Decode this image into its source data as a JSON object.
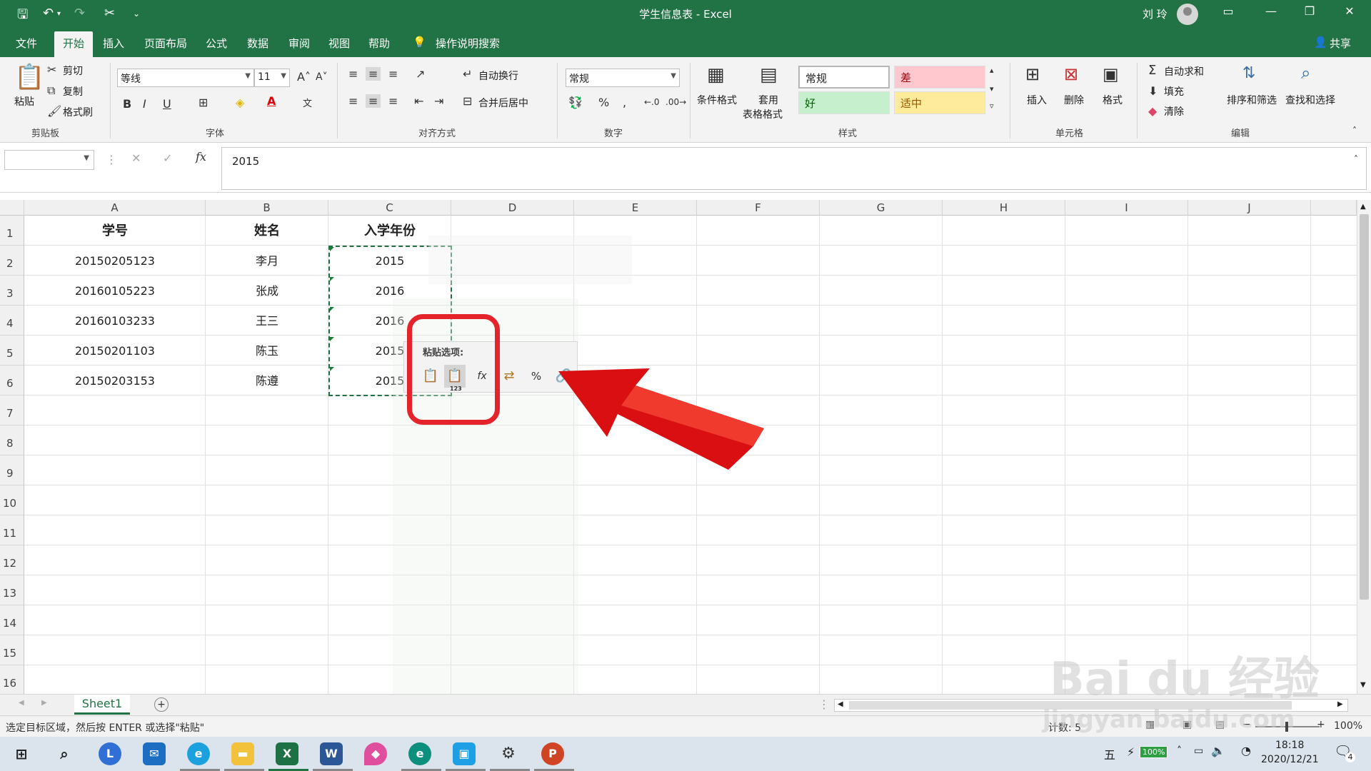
{
  "window": {
    "title": "学生信息表 - Excel",
    "user": "刘 玲"
  },
  "tabs": [
    "文件",
    "开始",
    "插入",
    "页面布局",
    "公式",
    "数据",
    "审阅",
    "视图",
    "帮助"
  ],
  "search_tab": "操作说明搜索",
  "share": "共享",
  "ribbon": {
    "clipboard": {
      "paste": "粘贴",
      "cut": "剪切",
      "copy": "复制",
      "painter": "格式刷",
      "label": "剪贴板"
    },
    "font": {
      "name": "等线",
      "size": "11",
      "label": "字体"
    },
    "align": {
      "wrap": "自动换行",
      "merge": "合并后居中",
      "label": "对齐方式"
    },
    "number": {
      "format": "常规",
      "label": "数字"
    },
    "styles": {
      "cond": "条件格式",
      "table1": "套用",
      "table2": "表格格式",
      "normal": "常规",
      "bad": "差",
      "good": "好",
      "neutral": "适中",
      "label": "样式"
    },
    "cells": {
      "insert": "插入",
      "delete": "删除",
      "format": "格式",
      "label": "单元格"
    },
    "edit": {
      "autosum": "自动求和",
      "fill": "填充",
      "clear": "清除",
      "sort": "排序和筛选",
      "find": "查找和选择",
      "label": "编辑"
    }
  },
  "formula": {
    "value": "2015"
  },
  "columns": [
    "A",
    "B",
    "C",
    "D",
    "E",
    "F",
    "G",
    "H",
    "I",
    "J"
  ],
  "rows": [
    "1",
    "2",
    "3",
    "4",
    "5",
    "6",
    "7",
    "8",
    "9",
    "10",
    "11",
    "12",
    "13",
    "14",
    "15",
    "16"
  ],
  "table": {
    "headers": [
      "学号",
      "姓名",
      "入学年份"
    ],
    "data": [
      [
        "20150205123",
        "李月",
        "2015"
      ],
      [
        "20160105223",
        "张成",
        "2016"
      ],
      [
        "20160103233",
        "王三",
        "2016"
      ],
      [
        "20150201103",
        "陈玉",
        "2015"
      ],
      [
        "20150203153",
        "陈遵",
        "2015"
      ]
    ]
  },
  "paste_menu": {
    "title": "粘贴选项:",
    "values_badge": "123"
  },
  "sheet": {
    "name": "Sheet1"
  },
  "status": {
    "text": "选定目标区域，然后按 ENTER 或选择\"粘贴\"",
    "count": "计数: 5",
    "zoom": "100%"
  },
  "taskbar": {
    "time": "18:18",
    "date": "2020/12/21",
    "ime": "五",
    "battery": "100%",
    "notif": "4"
  },
  "watermark": {
    "brand": "Bai du 经验",
    "url": "jingyan.baidu.com"
  }
}
